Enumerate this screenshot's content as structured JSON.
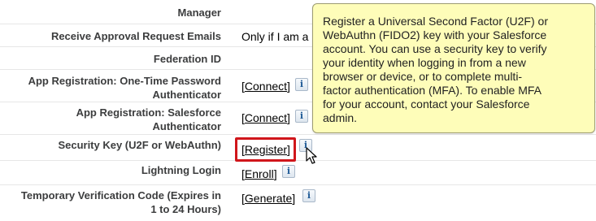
{
  "rows": [
    {
      "label": "Manager",
      "value": ""
    },
    {
      "label": "Receive Approval Request Emails",
      "value": "Only if I am a"
    },
    {
      "label": "Federation ID",
      "value": ""
    },
    {
      "label": "App Registration: One-Time Password Authenticator",
      "label_line1": "App Registration: One-Time Password",
      "label_line2": "Authenticator",
      "link": "Connect"
    },
    {
      "label": "App Registration: Salesforce Authenticator",
      "label_line1": "App Registration: Salesforce",
      "label_line2": "Authenticator",
      "link": "Connect"
    },
    {
      "label": "Security Key (U2F or WebAuthn)",
      "link": "Register"
    },
    {
      "label": "Lightning Login",
      "link": "Enroll"
    },
    {
      "label": "Temporary Verification Code (Expires in 1 to 24 Hours)",
      "label_line1": "Temporary Verification Code (Expires in",
      "label_line2": "1 to 24 Hours)",
      "link": "Generate"
    }
  ],
  "tooltip": {
    "lines": [
      "Register a Universal Second Factor (U2F) or",
      "WebAuthn (FIDO2) key with your Salesforce",
      "account. You can use a security key to verify",
      "your identity when logging in from a new",
      "browser or device, or to complete multi-",
      "factor authentication (MFA). To enable MFA",
      "for your account, contact your Salesforce",
      "admin."
    ]
  },
  "icons": {
    "info": "i",
    "info_name": "info-icon"
  },
  "colors": {
    "tooltip_bg": "#fefdb9",
    "highlight": "#d0161b"
  }
}
